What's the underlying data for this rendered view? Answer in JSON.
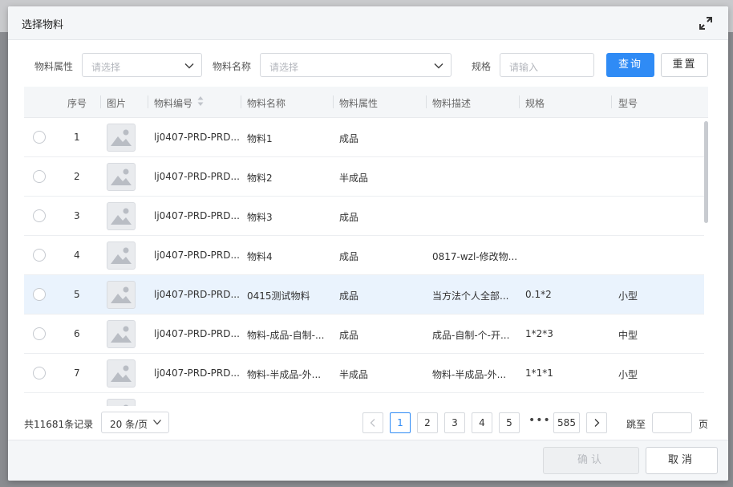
{
  "modal": {
    "title": "选择物料"
  },
  "filters": {
    "attr_label": "物料属性",
    "attr_placeholder": "请选择",
    "name_label": "物料名称",
    "name_placeholder": "请选择",
    "spec_label": "规格",
    "spec_placeholder": "请输入",
    "query_button": "查询",
    "reset_button": "重置"
  },
  "table": {
    "headers": [
      "序号",
      "图片",
      "物料编号",
      "物料名称",
      "物料属性",
      "物料描述",
      "规格",
      "型号"
    ],
    "rows": [
      {
        "index": "1",
        "code": "lj0407-PRD-PRD...",
        "name": "物料1",
        "attr": "成品",
        "desc": "",
        "spec": "",
        "model": ""
      },
      {
        "index": "2",
        "code": "lj0407-PRD-PRD...",
        "name": "物料2",
        "attr": "半成品",
        "desc": "",
        "spec": "",
        "model": ""
      },
      {
        "index": "3",
        "code": "lj0407-PRD-PRD...",
        "name": "物料3",
        "attr": "成品",
        "desc": "",
        "spec": "",
        "model": ""
      },
      {
        "index": "4",
        "code": "lj0407-PRD-PRD...",
        "name": "物料4",
        "attr": "成品",
        "desc": "0817-wzl-修改物...",
        "spec": "",
        "model": ""
      },
      {
        "index": "5",
        "code": "lj0407-PRD-PRD...",
        "name": "0415测试物料",
        "attr": "成品",
        "desc": "当方法个人全部...",
        "spec": "0.1*2",
        "model": "小型"
      },
      {
        "index": "6",
        "code": "lj0407-PRD-PRD...",
        "name": "物料-成品-自制-...",
        "attr": "成品",
        "desc": "成品-自制-个-开...",
        "spec": "1*2*3",
        "model": "中型"
      },
      {
        "index": "7",
        "code": "lj0407-PRD-PRD...",
        "name": "物料-半成品-外...",
        "attr": "半成品",
        "desc": "物料-半成品-外...",
        "spec": "1*1*1",
        "model": "小型"
      }
    ]
  },
  "pagination": {
    "total_text": "共11681条记录",
    "page_size": "20 条/页",
    "pages": [
      "1",
      "2",
      "3",
      "4",
      "5"
    ],
    "ellipsis": "•••",
    "last_page": "585",
    "current_page": "1",
    "jump_label": "跳至",
    "page_suffix": "页"
  },
  "footer": {
    "confirm": "确认",
    "cancel": "取消"
  },
  "colors": {
    "primary": "#2f8bf5",
    "row_highlight": "#eaf3fd",
    "header_bg": "#f4f6f8"
  }
}
